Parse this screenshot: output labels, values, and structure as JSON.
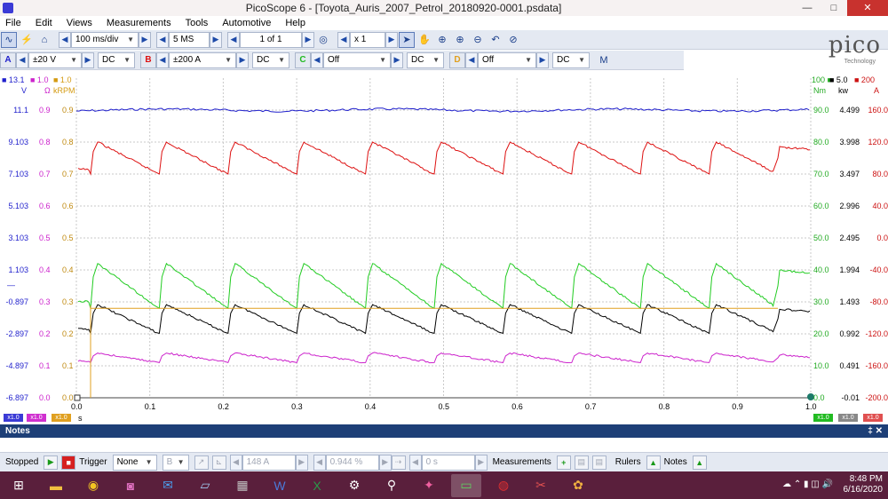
{
  "window": {
    "title": "PicoScope 6 - [Toyota_Auris_2007_Petrol_20180920-0001.psdata]",
    "minimize": "—",
    "maximize": "□",
    "close": "✕"
  },
  "menu": [
    "File",
    "Edit",
    "Views",
    "Measurements",
    "Tools",
    "Automotive",
    "Help"
  ],
  "toolbar": {
    "timebase": "100 ms/div",
    "samples": "5 MS",
    "buffer": "1 of 1",
    "zoom": "x 1",
    "logo": "pico",
    "logo_sub": "Technology"
  },
  "channels": [
    {
      "letter": "A",
      "range": "±20 V",
      "coupling": "DC",
      "color": "#2222cc"
    },
    {
      "letter": "B",
      "range": "±200 A",
      "coupling": "DC",
      "color": "#dd1111"
    },
    {
      "letter": "C",
      "range": "Off",
      "coupling": "DC",
      "color": "#22bb22"
    },
    {
      "letter": "D",
      "range": "Off",
      "coupling": "DC",
      "color": "#e0a020"
    }
  ],
  "axes": {
    "left_headers": [
      {
        "text": "13.1",
        "unit": "V",
        "color": "#1f1fcc"
      },
      {
        "text": "1.0",
        "unit": "Ω",
        "color": "#cc22cc"
      },
      {
        "text": "1.0",
        "unit": "kRPM",
        "color": "#d49a10"
      }
    ],
    "right_headers": [
      {
        "text": "100",
        "unit": "Nm",
        "color": "#22aa22"
      },
      {
        "text": "5.0",
        "unit": "kw",
        "color": "#000000"
      },
      {
        "text": "200",
        "unit": "A",
        "color": "#cc1111"
      }
    ],
    "volt_ticks": [
      "11.1",
      "9.103",
      "7.103",
      "5.103",
      "3.103",
      "1.103",
      "-0.897",
      "-2.897",
      "-4.897",
      "-6.897"
    ],
    "ohm_ticks": [
      "0.9",
      "0.8",
      "0.7",
      "0.6",
      "0.5",
      "0.4",
      "0.3",
      "0.2",
      "0.1",
      "0.0"
    ],
    "rpm_ticks": [
      "0.9",
      "0.8",
      "0.7",
      "0.6",
      "0.5",
      "0.4",
      "0.3",
      "0.2",
      "0.1",
      "0.0"
    ],
    "nm_ticks": [
      "90.0",
      "80.0",
      "70.0",
      "60.0",
      "50.0",
      "40.0",
      "30.0",
      "20.0",
      "10.0",
      "0.0"
    ],
    "kw_ticks": [
      "4.499",
      "3.998",
      "3.497",
      "2.996",
      "2.495",
      "1.994",
      "1.493",
      "0.992",
      "0.491",
      "-0.01"
    ],
    "amp_ticks": [
      "160.0",
      "120.0",
      "80.0",
      "40.0",
      "0.0",
      "-40.0",
      "-80.0",
      "-120.0",
      "-160.0",
      "-200.0"
    ],
    "time_ticks": [
      "0.0",
      "0.1",
      "0.2",
      "0.3",
      "0.4",
      "0.5",
      "0.6",
      "0.7",
      "0.8",
      "0.9",
      "1.0"
    ],
    "time_unit": "s",
    "scale_left": [
      "x1.0",
      "x1.0",
      "x1.0"
    ],
    "scale_right": [
      "x1.0",
      "x1.0",
      "x1.0"
    ]
  },
  "chart_data": {
    "type": "line",
    "x_range": [
      0.0,
      1.0
    ],
    "x_label": "s",
    "series": [
      {
        "name": "A",
        "color": "#1f1fcc",
        "pattern": "flat",
        "level": 11.1,
        "units": "V"
      },
      {
        "name": "B",
        "color": "#dd1111",
        "pattern": "sawtooth",
        "peak": 120.0,
        "trough": 80.0,
        "units": "A"
      },
      {
        "name": "C",
        "color": "#22cc22",
        "pattern": "sawtooth",
        "peak": 42.0,
        "trough": 28.0,
        "units": "Nm"
      },
      {
        "name": "kw",
        "color": "#000000",
        "pattern": "sawtooth",
        "peak": 1.45,
        "trough": 1.0,
        "units": "kw"
      },
      {
        "name": "ohm",
        "color": "#cc22cc",
        "pattern": "sawtooth",
        "peak": 0.14,
        "trough": 0.11,
        "units": "Ω"
      },
      {
        "name": "D",
        "color": "#e0a020",
        "pattern": "flat",
        "level": 0.28,
        "units": "kRPM"
      }
    ],
    "cycles": 10
  },
  "notes": {
    "title": "Notes",
    "pin": "‡ ✕"
  },
  "status": {
    "state": "Stopped",
    "trigger_label": "Trigger",
    "trigger_mode": "None",
    "trig_channel": "B",
    "trig_level": "148 A",
    "trig_pct": "0.944 %",
    "trig_delay": "0 s",
    "measurements": "Measurements",
    "rulers": "Rulers",
    "notes": "Notes"
  },
  "taskbar": {
    "time": "8:48 PM",
    "date": "6/16/2020"
  }
}
